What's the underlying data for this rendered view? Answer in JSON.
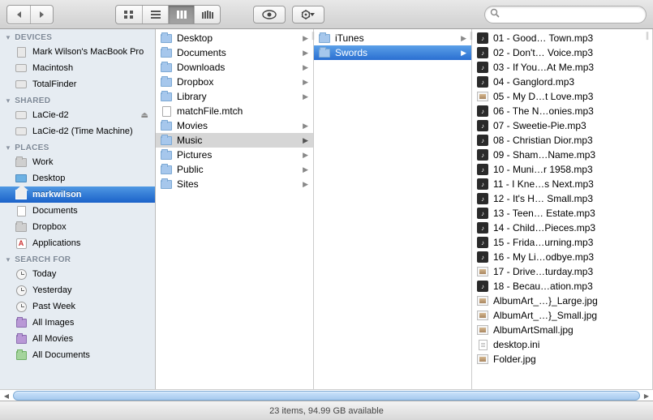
{
  "toolbar": {
    "search_placeholder": ""
  },
  "sidebar": {
    "sections": [
      {
        "title": "DEVICES",
        "items": [
          {
            "label": "Mark Wilson's MacBook Pro",
            "icon": "mac"
          },
          {
            "label": "Macintosh",
            "icon": "hdd"
          },
          {
            "label": "TotalFinder",
            "icon": "hdd-w"
          }
        ]
      },
      {
        "title": "SHARED",
        "items": [
          {
            "label": "LaCie-d2",
            "icon": "ext",
            "eject": true
          },
          {
            "label": "LaCie-d2 (Time Machine)",
            "icon": "ext"
          }
        ]
      },
      {
        "title": "PLACES",
        "items": [
          {
            "label": "Work",
            "icon": "folder-grey"
          },
          {
            "label": "Desktop",
            "icon": "desk"
          },
          {
            "label": "markwilson",
            "icon": "home",
            "selected": true
          },
          {
            "label": "Documents",
            "icon": "file"
          },
          {
            "label": "Dropbox",
            "icon": "folder-grey"
          },
          {
            "label": "Applications",
            "icon": "app"
          }
        ]
      },
      {
        "title": "SEARCH FOR",
        "items": [
          {
            "label": "Today",
            "icon": "clock"
          },
          {
            "label": "Yesterday",
            "icon": "clock"
          },
          {
            "label": "Past Week",
            "icon": "clock"
          },
          {
            "label": "All Images",
            "icon": "smart"
          },
          {
            "label": "All Movies",
            "icon": "smart"
          },
          {
            "label": "All Documents",
            "icon": "smart-g"
          }
        ]
      }
    ]
  },
  "columns": [
    {
      "items": [
        {
          "label": "Desktop",
          "icon": "folder",
          "folder": true
        },
        {
          "label": "Documents",
          "icon": "folder",
          "folder": true
        },
        {
          "label": "Downloads",
          "icon": "folder",
          "folder": true
        },
        {
          "label": "Dropbox",
          "icon": "folder",
          "folder": true
        },
        {
          "label": "Library",
          "icon": "folder",
          "folder": true
        },
        {
          "label": "matchFile.mtch",
          "icon": "file",
          "folder": false
        },
        {
          "label": "Movies",
          "icon": "folder",
          "folder": true
        },
        {
          "label": "Music",
          "icon": "folder",
          "folder": true,
          "selected": true
        },
        {
          "label": "Pictures",
          "icon": "folder",
          "folder": true
        },
        {
          "label": "Public",
          "icon": "folder",
          "folder": true
        },
        {
          "label": "Sites",
          "icon": "folder",
          "folder": true
        }
      ]
    },
    {
      "items": [
        {
          "label": "iTunes",
          "icon": "folder",
          "folder": true
        },
        {
          "label": "Swords",
          "icon": "folder",
          "folder": true,
          "active": true
        }
      ]
    },
    {
      "items": [
        {
          "label": "01 - Good… Town.mp3",
          "icon": "mp3"
        },
        {
          "label": "02 - Don't… Voice.mp3",
          "icon": "mp3"
        },
        {
          "label": "03 - If You…At Me.mp3",
          "icon": "mp3"
        },
        {
          "label": "04 - Ganglord.mp3",
          "icon": "mp3"
        },
        {
          "label": "05 - My D…t Love.mp3",
          "icon": "img"
        },
        {
          "label": "06 - The N…onies.mp3",
          "icon": "mp3"
        },
        {
          "label": "07 - Sweetie-Pie.mp3",
          "icon": "mp3"
        },
        {
          "label": "08 - Christian Dior.mp3",
          "icon": "mp3"
        },
        {
          "label": "09 - Sham…Name.mp3",
          "icon": "mp3"
        },
        {
          "label": "10 - Muni…r 1958.mp3",
          "icon": "mp3"
        },
        {
          "label": "11 - I Kne…s Next.mp3",
          "icon": "mp3"
        },
        {
          "label": "12 - It's H… Small.mp3",
          "icon": "mp3"
        },
        {
          "label": "13 - Teen… Estate.mp3",
          "icon": "mp3"
        },
        {
          "label": "14 - Child…Pieces.mp3",
          "icon": "mp3"
        },
        {
          "label": "15 - Frida…urning.mp3",
          "icon": "mp3"
        },
        {
          "label": "16 - My Li…odbye.mp3",
          "icon": "mp3"
        },
        {
          "label": "17 - Drive…turday.mp3",
          "icon": "img"
        },
        {
          "label": "18 - Becau…ation.mp3",
          "icon": "mp3"
        },
        {
          "label": "AlbumArt_…}_Large.jpg",
          "icon": "img"
        },
        {
          "label": "AlbumArt_…}_Small.jpg",
          "icon": "img"
        },
        {
          "label": "AlbumArtSmall.jpg",
          "icon": "img"
        },
        {
          "label": "desktop.ini",
          "icon": "txt"
        },
        {
          "label": "Folder.jpg",
          "icon": "img"
        }
      ]
    }
  ],
  "status": "23 items, 94.99 GB available"
}
